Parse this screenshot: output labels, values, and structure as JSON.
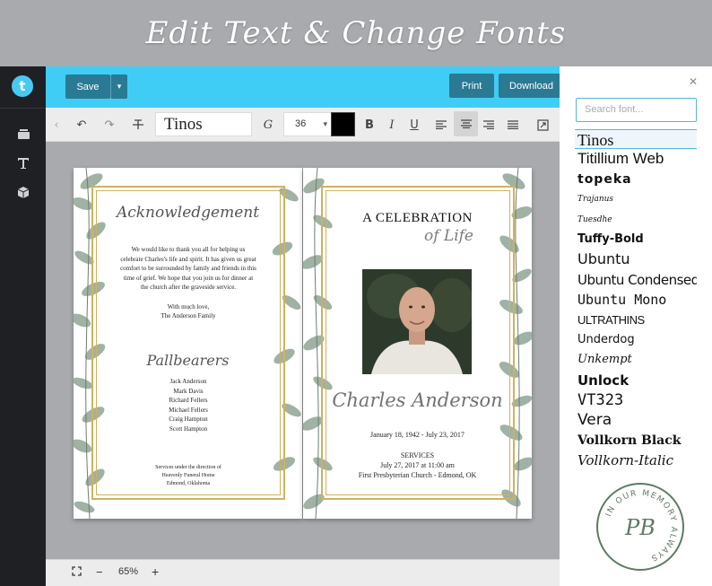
{
  "banner": {
    "title": "Edit Text & Change Fonts"
  },
  "app": {
    "logo_letter": "t"
  },
  "rail": {
    "icons": [
      "layers-icon",
      "text-tool-icon",
      "cube-icon"
    ]
  },
  "topbar": {
    "save": "Save",
    "print": "Print",
    "download": "Download"
  },
  "toolbar": {
    "font": "Tinos",
    "size": "36",
    "color": "#000000",
    "bold": "B",
    "italic": "I",
    "underline": "U"
  },
  "left_page": {
    "heading": "Acknowledgement",
    "message": "We would like to thank you all for helping us celebrate Charles's life and spirit. It has given us great comfort to be surrounded by family and friends in this time of grief. We hope that you join us for dinner at the church after the graveside service.",
    "closing": "With much love,",
    "signature": "The Anderson Family",
    "pallbearers_heading": "Pallbearers",
    "pallbearers": [
      "Jack Anderson",
      "Mark Davis",
      "Richard Fellers",
      "Michael Fellers",
      "Craig Hampton",
      "Scott Hampton"
    ],
    "services_1": "Services under the direction of",
    "services_2": "Heavenly Funeral Home",
    "services_3": "Edmond, Oklahoma"
  },
  "right_page": {
    "title_1": "A CELEBRATION",
    "title_2": "of Life",
    "name": "Charles Anderson",
    "dates": "January 18, 1942 - July 23, 2017",
    "services_label": "SERVICES",
    "service_time": "July 27, 2017 at 11:00 am",
    "service_place": "First Presbyterian Church - Edmond, OK"
  },
  "bottombar": {
    "zoom": "65%",
    "minus": "−",
    "plus": "+"
  },
  "panel": {
    "search_placeholder": "Search font...",
    "fonts": [
      "Tinos",
      "Titillium Web",
      "topeka",
      "Trajanus",
      "Tuesdhe",
      "Tuffy-Bold",
      "Ubuntu",
      "Ubuntu Condensed",
      "Ubuntu Mono",
      "ULTRATHINS",
      "Underdog",
      "Unkempt",
      "Unlock",
      "VT323",
      "Vera",
      "Vollkorn Black",
      "Vollkorn-Italic"
    ],
    "stamp_text": "IN OUR MEMORY ALWAYS",
    "stamp_initials": "PB"
  },
  "colors": {
    "accent": "#3fcdf6",
    "button": "#2a7a93",
    "rail": "#1f2023",
    "gold": "#cfb25e",
    "stamp": "#5d7a64"
  }
}
